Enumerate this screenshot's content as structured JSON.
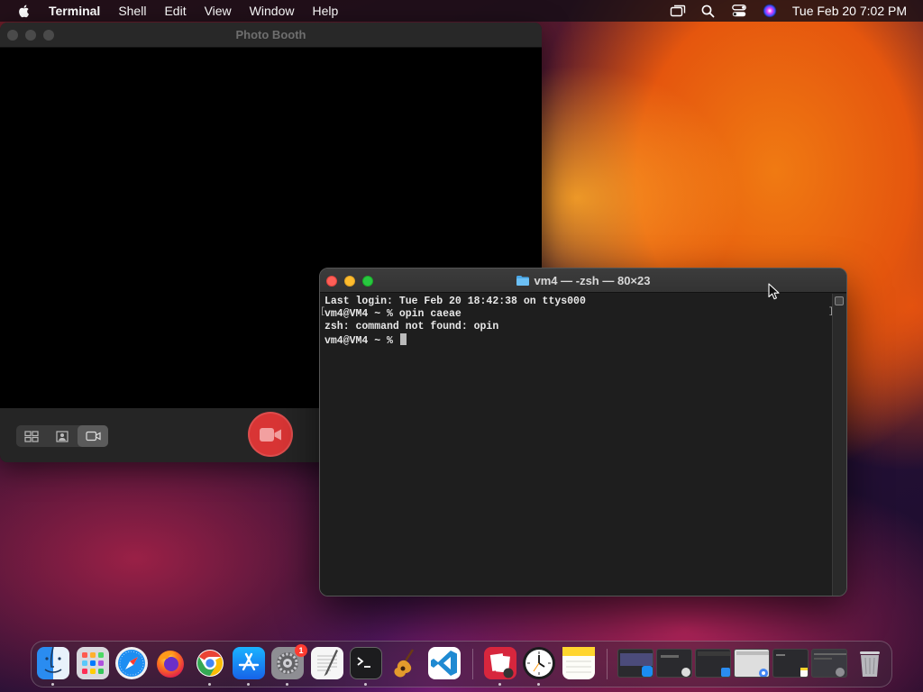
{
  "menubar": {
    "app_name": "Terminal",
    "items": [
      "Shell",
      "Edit",
      "View",
      "Window",
      "Help"
    ],
    "clock": "Tue Feb 20  7:02 PM"
  },
  "photobooth": {
    "title": "Photo Booth",
    "view_modes": [
      "grid-view",
      "single-photo",
      "video"
    ],
    "selected_mode": "video"
  },
  "terminal": {
    "title": "vm4 — -zsh — 80×23",
    "lines": [
      "Last login: Tue Feb 20 18:42:38 on ttys000",
      "vm4@VM4 ~ % opin caeae",
      "zsh: command not found: opin",
      "vm4@VM4 ~ % "
    ]
  },
  "dock": {
    "apps": [
      "Finder",
      "Launchpad",
      "Safari",
      "Firefox",
      "Google Chrome",
      "App Store",
      "System Settings",
      "TextEdit",
      "Terminal",
      "GarageBand",
      "Visual Studio Code",
      "Photo Booth",
      "Clock",
      "Notes"
    ],
    "system_settings_badge": "1",
    "active_apps": [
      "Finder",
      "Google Chrome",
      "App Store",
      "System Settings",
      "Terminal",
      "Photo Booth",
      "Clock"
    ]
  },
  "colors": {
    "accent_record": "#d93535",
    "close": "#fe5f57",
    "minimize": "#febc2e",
    "zoom": "#28c840"
  }
}
